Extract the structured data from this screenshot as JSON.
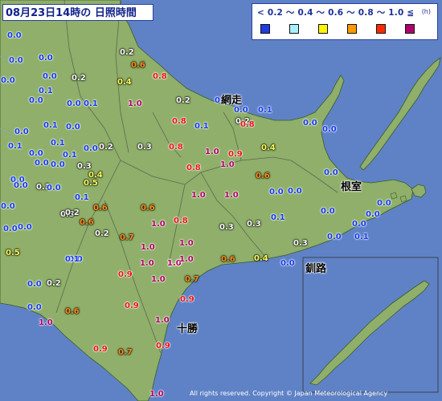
{
  "title": {
    "date": "08月23日14時の",
    "element": "日照時間"
  },
  "legend": {
    "ranges": [
      "<0.2",
      "〜0.4",
      "〜0.6",
      "〜0.8",
      "〜1.0",
      "1.0≦"
    ],
    "line": "< 0.2 〜 0.4 〜 0.6 〜 0.8 〜 1.0 ≦",
    "unit": "(h)",
    "colors": [
      "#1f3de0",
      "#a8f0ff",
      "#fff500",
      "#ff9900",
      "#ff2a00",
      "#b0006b"
    ]
  },
  "place_names": [
    "網走",
    "根室",
    "釧路",
    "十勝"
  ],
  "readings": [
    "0.0",
    "0.0",
    "0.0",
    "0.0",
    "0.0",
    "0.2",
    "0.6",
    "0.0",
    "0.2",
    "0.4",
    "0.8",
    "0.1",
    "0.0",
    "0.1",
    "1.0",
    "0.2",
    "0.0",
    "0.0",
    "0.2",
    "0.1",
    "0.8",
    "0.1",
    "0.8",
    "0.0",
    "0.0",
    "0.1",
    "0.0",
    "0.2",
    "0.0",
    "0.1",
    "0.1",
    "0.1",
    "0.0",
    "0.0",
    "0.0",
    "0.3",
    "0.6",
    "1.0",
    "0.9",
    "0.4",
    "0.0",
    "0.0",
    "0.3",
    "0.3",
    "0.8",
    "0.8",
    "1.0",
    "0.0",
    "0.0",
    "0.4",
    "0.6",
    "0.0",
    "0.5",
    "0.1",
    "1.0",
    "1.0",
    "0.3",
    "0.0",
    "0.0",
    "0.0",
    "0.0",
    "0.6",
    "0.0",
    "0.0",
    "0.1",
    "0.0",
    "0.2",
    "0.6",
    "1.0",
    "0.8",
    "0.0",
    "0.0",
    "0.2",
    "0.3",
    "0.3",
    "0.1",
    "0.0",
    "0.7",
    "0.0",
    "1.0",
    "1.0",
    "0.3",
    "0.5",
    "0.0",
    "1.0",
    "1.0",
    "0.6",
    "0.4",
    "0.0",
    "0.9",
    "1.0",
    "0.7",
    "0.1",
    "0.2",
    "1.0",
    "0.9",
    "0.9",
    "0.0",
    "0.6",
    "1.0",
    "1.0",
    "1.0",
    "0.9",
    "0.7",
    "0.9",
    "1.0"
  ],
  "copyright": "All rights reserved. Copyright © Japan Meteorological Agency"
}
